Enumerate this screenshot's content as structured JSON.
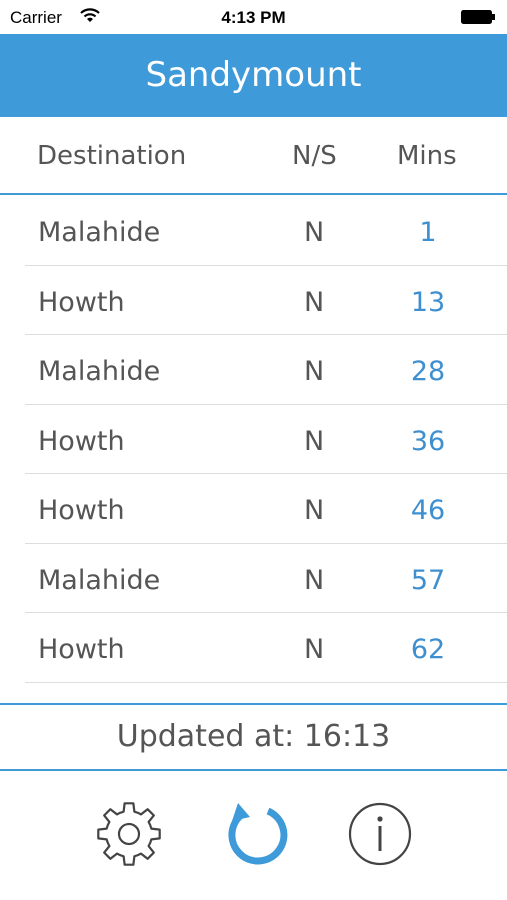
{
  "status_bar": {
    "carrier": "Carrier",
    "time": "4:13 PM"
  },
  "header": {
    "title": "Sandymount"
  },
  "columns": {
    "destination": "Destination",
    "direction": "N/S",
    "minutes": "Mins"
  },
  "departures": [
    {
      "destination": "Malahide",
      "direction": "N",
      "minutes": "1"
    },
    {
      "destination": "Howth",
      "direction": "N",
      "minutes": "13"
    },
    {
      "destination": "Malahide",
      "direction": "N",
      "minutes": "28"
    },
    {
      "destination": "Howth",
      "direction": "N",
      "minutes": "36"
    },
    {
      "destination": "Howth",
      "direction": "N",
      "minutes": "46"
    },
    {
      "destination": "Malahide",
      "direction": "N",
      "minutes": "57"
    },
    {
      "destination": "Howth",
      "direction": "N",
      "minutes": "62"
    }
  ],
  "footer": {
    "updated": "Updated at: 16:13"
  },
  "toolbar": {
    "settings_icon": "gear-icon",
    "refresh_icon": "refresh-icon",
    "info_icon": "info-icon"
  },
  "colors": {
    "accent": "#3e9ad8",
    "text": "#555555",
    "divider": "#dddddd"
  }
}
